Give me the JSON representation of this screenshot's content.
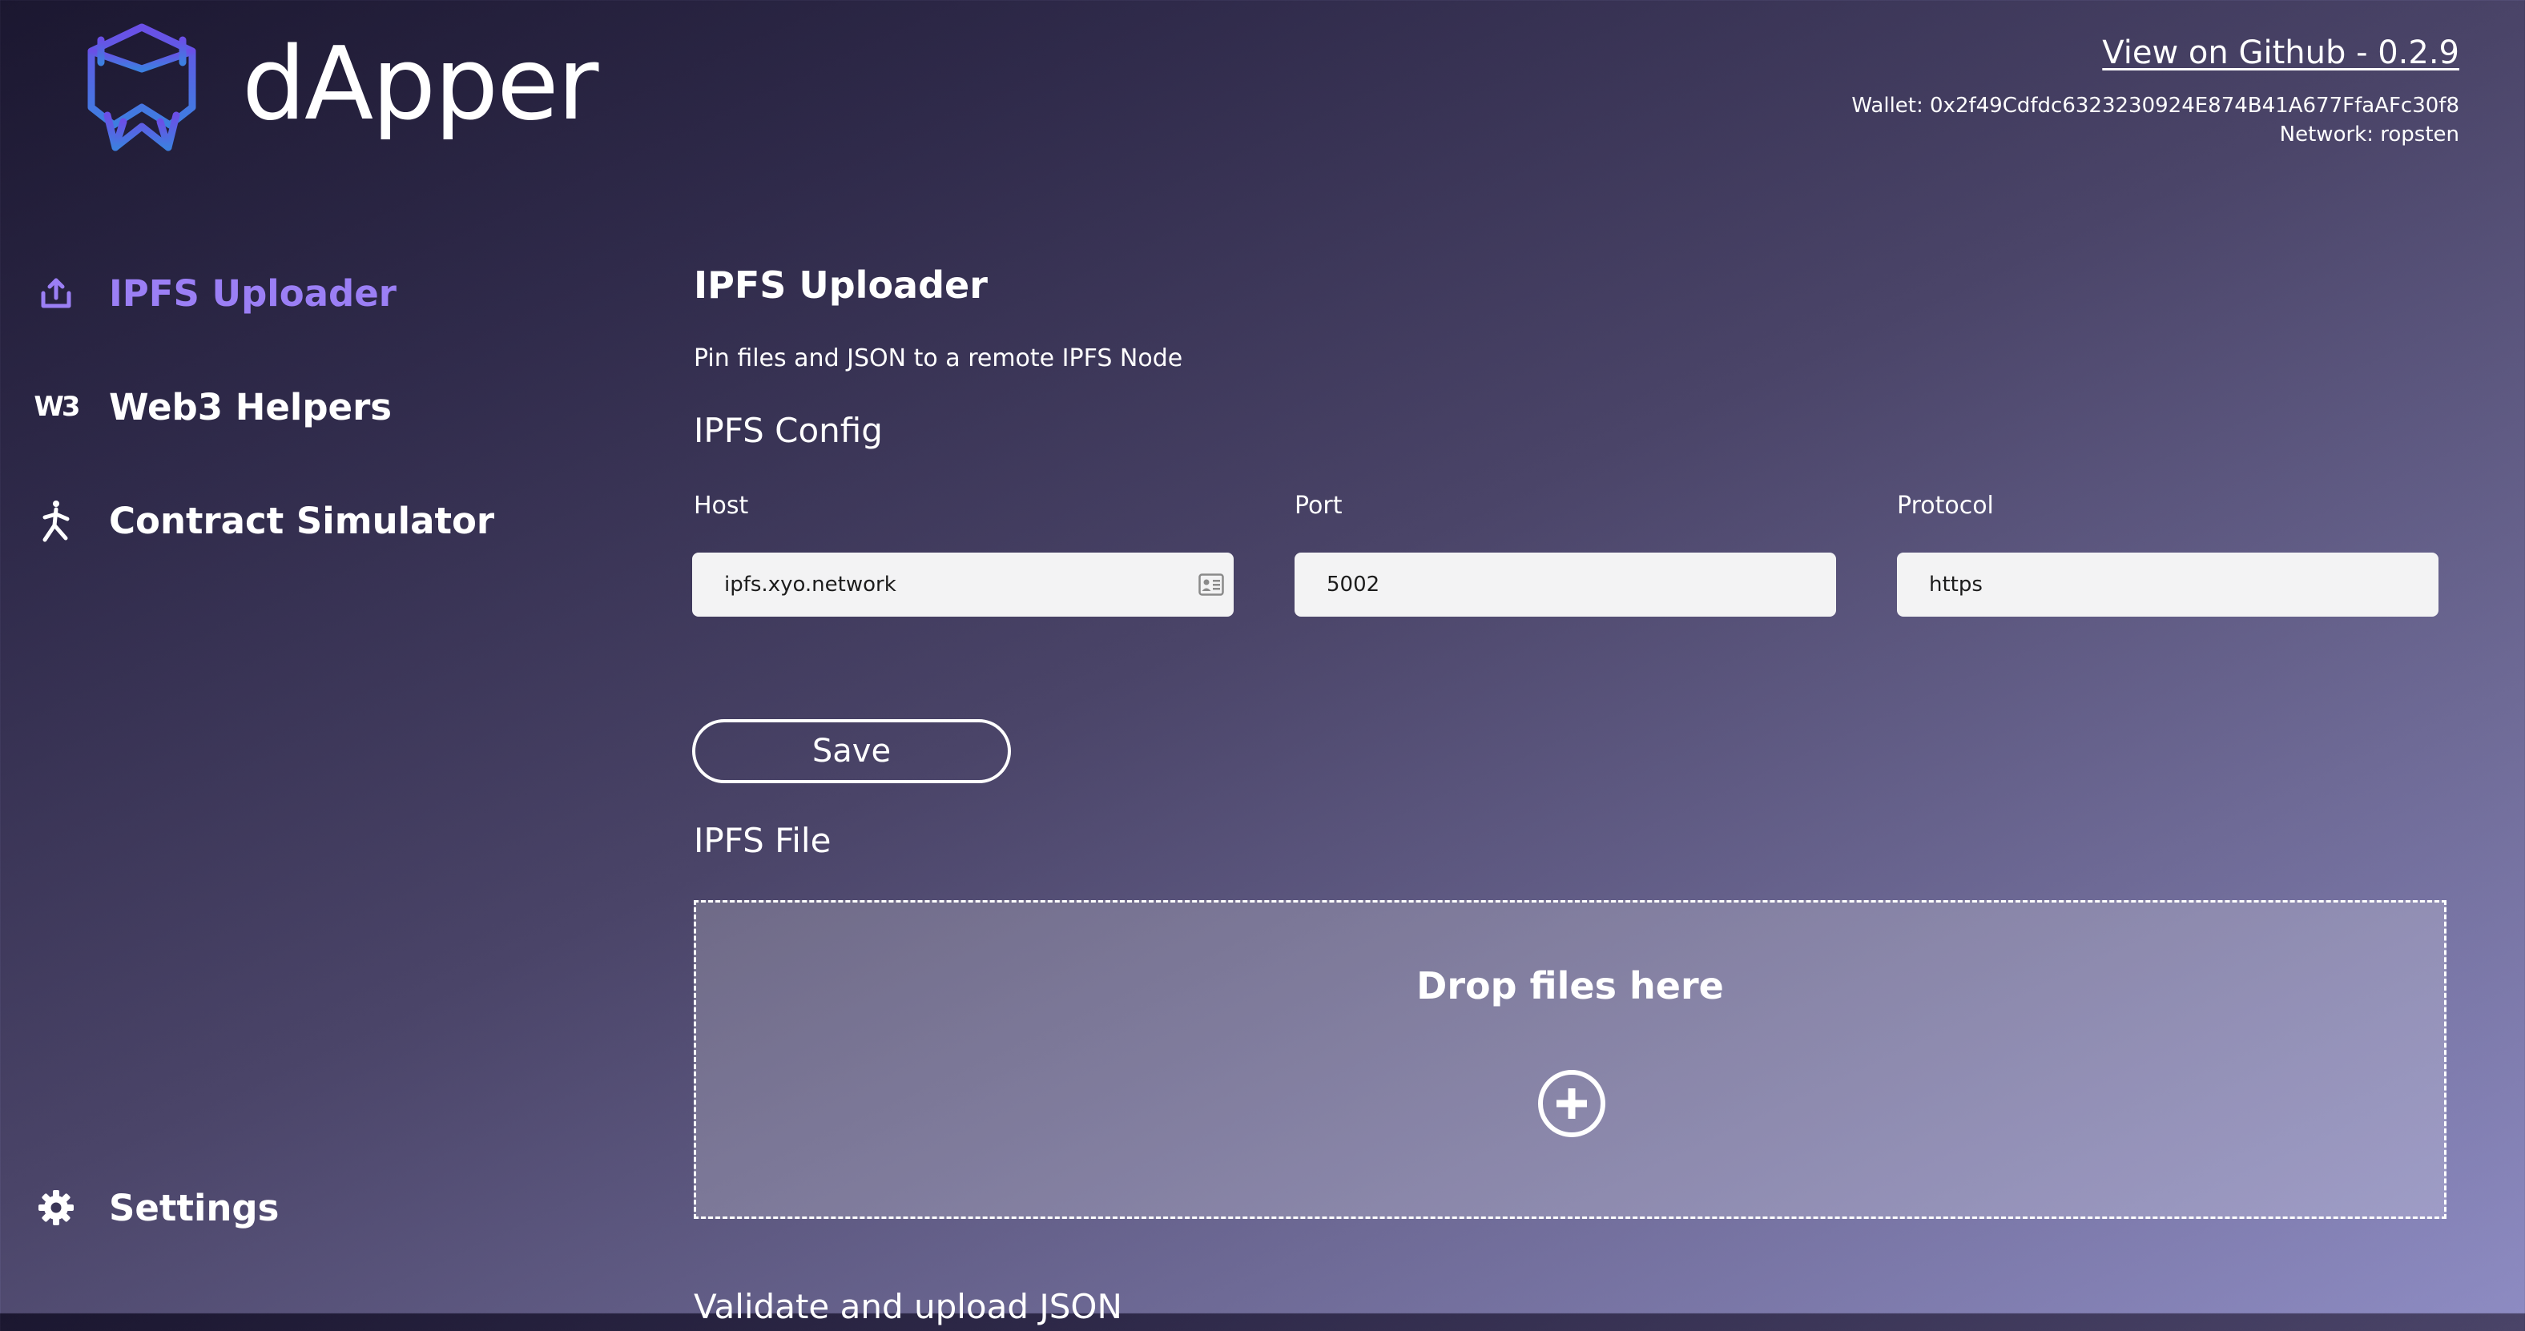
{
  "header": {
    "brand": "dApper",
    "github_link": "View on Github - 0.2.9",
    "wallet": "Wallet: 0x2f49Cdfdc6323230924E874B41A677FfaAFc30f8",
    "network": "Network: ropsten",
    "logo_colors": [
      "#6b4fe6",
      "#3d7fe0"
    ]
  },
  "sidebar": {
    "items": [
      {
        "label": "IPFS Uploader",
        "icon": "upload-icon",
        "active": true
      },
      {
        "label": "Web3 Helpers",
        "icon": "web3-icon",
        "icon_text": "W3",
        "active": false
      },
      {
        "label": "Contract Simulator",
        "icon": "running-person-icon",
        "active": false
      },
      {
        "label": "Settings",
        "icon": "gear-icon",
        "active": false
      }
    ],
    "active_color": "#9b7ff5"
  },
  "main": {
    "title": "IPFS Uploader",
    "description": "Pin files and JSON to a remote IPFS Node",
    "config_title": "IPFS Config",
    "fields": [
      {
        "label": "Host",
        "value": "ipfs.xyo.network"
      },
      {
        "label": "Port",
        "value": "5002"
      },
      {
        "label": "Protocol",
        "value": "https"
      }
    ],
    "save_label": "Save",
    "file_title": "IPFS File",
    "dropzone_text": "Drop files here",
    "json_title": "Validate and upload JSON"
  }
}
